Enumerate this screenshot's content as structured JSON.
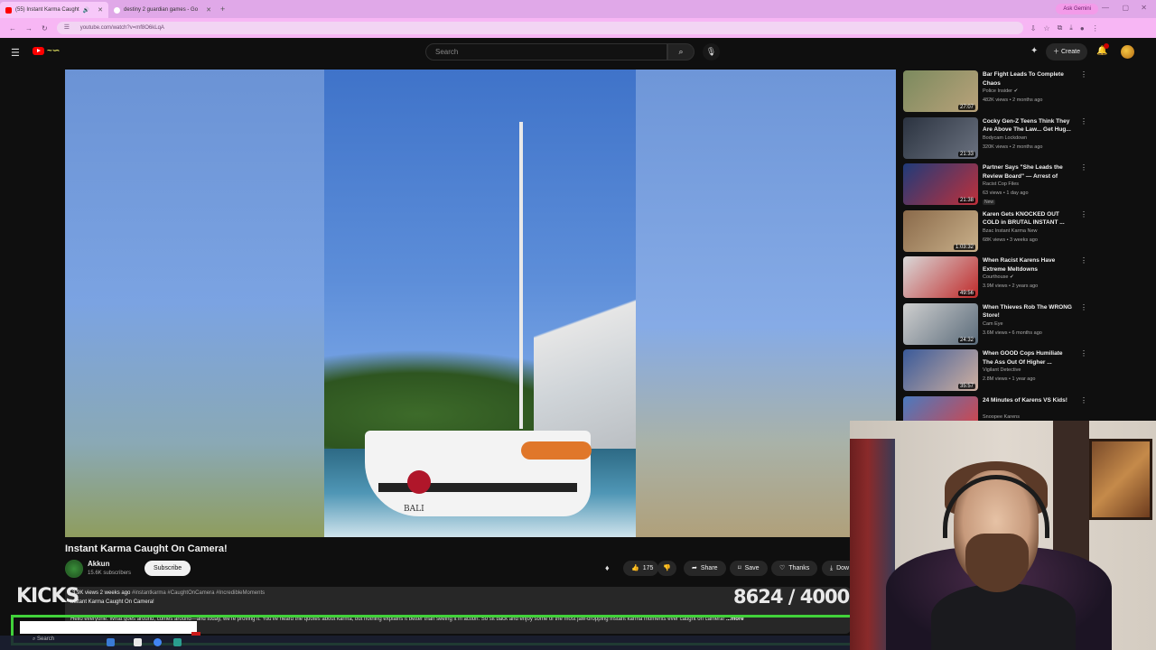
{
  "browser": {
    "tabs": [
      {
        "title": "(55) Instant Karma Caught",
        "active": true,
        "favicon_color": "#ff0000"
      },
      {
        "title": "destiny 2 guardian games - Go",
        "active": false,
        "favicon_color": "#ffffff"
      }
    ],
    "new_tab": "+",
    "ask_gemini": "Ask Gemini",
    "url": "youtube.com/watch?v=mf8O6kLqA"
  },
  "header": {
    "search_placeholder": "Search",
    "create_label": "Create"
  },
  "video": {
    "title": "Instant Karma Caught On Camera!",
    "hull_name": "BALI"
  },
  "channel": {
    "name": "Akkun",
    "subscribers": "15.6K subscribers",
    "subscribe_label": "Subscribe"
  },
  "actions": {
    "likes": "175",
    "share": "Share",
    "save": "Save",
    "thanks": "Thanks",
    "download": "Dow"
  },
  "description": {
    "meta": "3.9K views  2 weeks ago",
    "tags": "#instantkarma #CaughtOnCamera #IncredibleMoments",
    "line2": "Instant Karma Caught On Camera!",
    "body": "Hello everyone. What goes around, comes around—and today, we're proving it. You've heard the quotes about karma, but nothing explains it better than seeing it in action. So sit back and enjoy some of the most jaw-dropping instant karma moments ever caught on camera!",
    "more": "...more"
  },
  "overlay": {
    "kicks": "KICKS",
    "counter": "8624 / 40000"
  },
  "taskbar": {
    "search": "Search"
  },
  "recommendations": [
    {
      "title": "Bar Fight Leads To Complete Chaos",
      "channel": "Police Insider",
      "verified": true,
      "views": "482K views • 2 months ago",
      "duration": "27:07",
      "thumb": [
        "#7b8a5e",
        "#b9a27a"
      ]
    },
    {
      "title": "Cocky Gen-Z Teens Think They Are Above The Law... Get Hug...",
      "channel": "Bodycam Lockdown",
      "verified": false,
      "views": "320K views • 2 months ago",
      "duration": "21:33",
      "thumb": [
        "#2b3340",
        "#6b7280"
      ]
    },
    {
      "title": "Partner Says \"She Leads the Review Board\" — Arrest of Bla...",
      "channel": "Racist Cop Files",
      "verified": false,
      "views": "63 views • 1 day ago",
      "duration": "21:38",
      "badge": "New",
      "thumb": [
        "#1f3b7a",
        "#c0303a"
      ]
    },
    {
      "title": "Karen Gets KNOCKED OUT COLD in BRUTAL INSTANT ...",
      "channel": "Bzac Instant Karma New",
      "verified": false,
      "views": "68K views • 3 weeks ago",
      "duration": "1:03:32",
      "thumb": [
        "#8a6a4a",
        "#c9b08a"
      ]
    },
    {
      "title": "When Racist Karens Have Extreme Meltdowns",
      "channel": "Courthouse",
      "verified": true,
      "views": "3.9M views • 2 years ago",
      "duration": "49:56",
      "thumb": [
        "#d9d9d9",
        "#c02a2a"
      ]
    },
    {
      "title": "When Thieves Rob The WRONG Store!",
      "channel": "Cam Eye",
      "verified": false,
      "views": "3.6M views • 6 months ago",
      "duration": "24:32",
      "thumb": [
        "#cfcfcf",
        "#5a6b7a"
      ]
    },
    {
      "title": "When GOOD Cops Humiliate The Ass Out Of Higher ...",
      "channel": "Vigilant Detective",
      "verified": false,
      "views": "2.8M views • 1 year ago",
      "duration": "35:57",
      "thumb": [
        "#3a5a9a",
        "#d0b0a0"
      ]
    },
    {
      "title": "24 Minutes of Karens VS Kids!",
      "channel": "Snoopee Karens",
      "verified": false,
      "views": "1M views • 2 years ago",
      "duration": "",
      "thumb": [
        "#4a7ac0",
        "#e04040"
      ]
    }
  ]
}
